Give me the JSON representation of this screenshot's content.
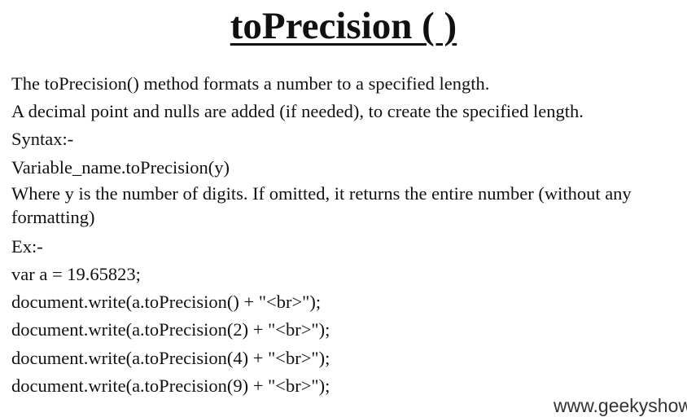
{
  "title": "toPrecision ( )",
  "lines": [
    "The toPrecision() method formats a number to a specified length.",
    "A decimal point and nulls are added (if needed), to create the specified length.",
    "Syntax:-",
    "Variable_name.toPrecision(y)",
    "Where y is the number of digits. If omitted, it returns the entire number (without any formatting)",
    "Ex:-",
    "var a = 19.65823;",
    "document.write(a.toPrecision() + \"<br>\");",
    "document.write(a.toPrecision(2) + \"<br>\");",
    "document.write(a.toPrecision(4) + \"<br>\");",
    "document.write(a.toPrecision(9) + \"<br>\");"
  ],
  "watermark": "www.geekyshow"
}
